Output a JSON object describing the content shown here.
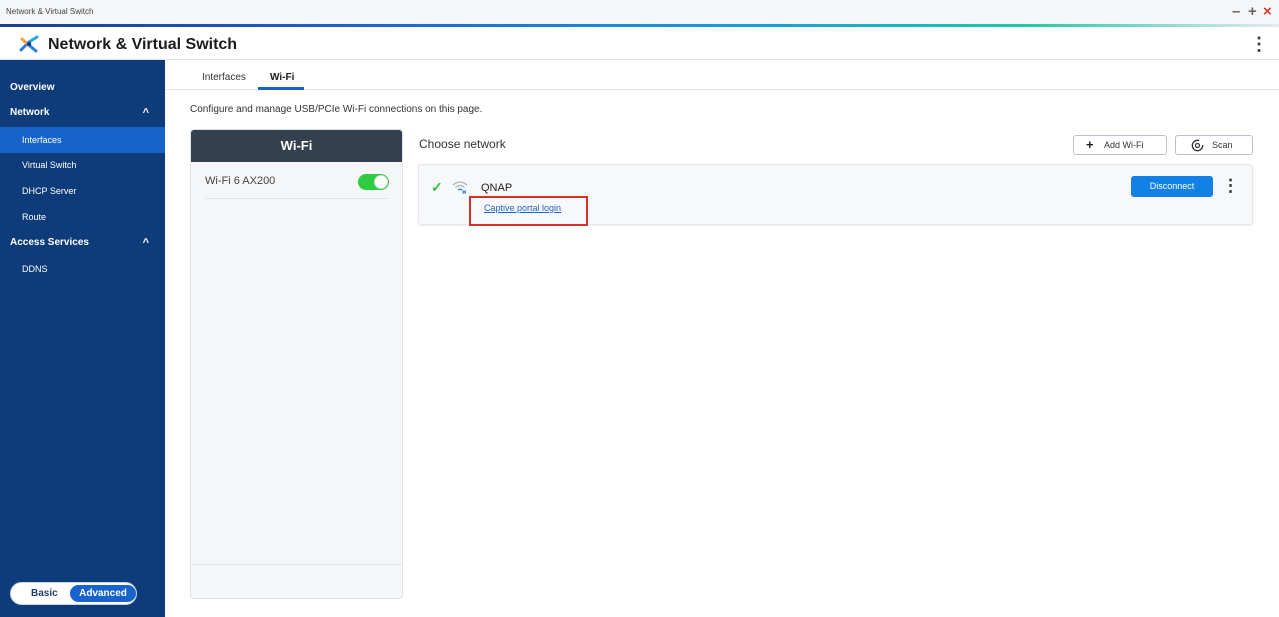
{
  "window": {
    "title": "Network & Virtual Switch",
    "controls": {
      "minimize": "–",
      "maximize": "+",
      "close": "×"
    }
  },
  "header": {
    "app_title": "Network & Virtual Switch",
    "app_icon": "network-virtual-switch-icon",
    "menu_icon": "kebab-menu-icon",
    "menu_glyph": "⋮"
  },
  "sidebar": {
    "items": [
      {
        "label": "Overview",
        "level": 0,
        "active": false
      },
      {
        "label": "Network",
        "level": 0,
        "active": false,
        "expanded": true,
        "chevron": "^"
      },
      {
        "label": "Interfaces",
        "level": 1,
        "active": true
      },
      {
        "label": "Virtual Switch",
        "level": 1,
        "active": false
      },
      {
        "label": "DHCP Server",
        "level": 1,
        "active": false
      },
      {
        "label": "Route",
        "level": 1,
        "active": false
      },
      {
        "label": "Access Services",
        "level": 0,
        "active": false,
        "expanded": true,
        "chevron": "^"
      },
      {
        "label": "DDNS",
        "level": 1,
        "active": false
      }
    ],
    "mode_toggle": {
      "basic": "Basic",
      "advanced": "Advanced",
      "selected": "Advanced"
    }
  },
  "tabs": [
    {
      "label": "Interfaces",
      "active": false
    },
    {
      "label": "Wi-Fi",
      "active": true
    }
  ],
  "description": "Configure and manage USB/PCIe Wi-Fi connections on this page.",
  "wifi_panel": {
    "header": "Wi-Fi",
    "adapters": [
      {
        "name": "Wi-Fi 6 AX200",
        "enabled": true
      }
    ]
  },
  "choose_network": {
    "title": "Choose network",
    "add_button": {
      "label": "Add Wi-Fi",
      "icon": "plus-icon",
      "glyph": "+"
    },
    "scan_button": {
      "label": "Scan",
      "icon": "scan-icon"
    },
    "networks": [
      {
        "connected_icon": "checkmark-icon",
        "check_glyph": "✓",
        "signal_icon": "wifi-signal-icon",
        "ssid": "QNAP",
        "portal_link": "Captive portal login",
        "action": "Disconnect",
        "menu_glyph": "⋮"
      }
    ]
  },
  "colors": {
    "sidebar_bg": "#0e3b7a",
    "sidebar_active": "#1763c9",
    "accent": "#1763c9",
    "toggle_on": "#2ecc40",
    "primary_button": "#1380e8",
    "highlight_box": "#d6302c",
    "check": "#2dbd3d",
    "close": "#e0332c"
  }
}
